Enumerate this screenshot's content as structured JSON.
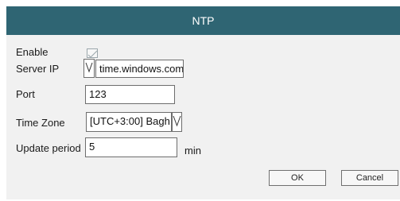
{
  "dialog": {
    "title": "NTP",
    "title_bar_color": "#2f6573"
  },
  "fields": {
    "enable_label": "Enable",
    "enable_checked": true,
    "server_ip_label": "Server IP",
    "server_ip_value": "time.windows.com",
    "port_label": "Port",
    "port_value": "123",
    "time_zone_label": "Time Zone",
    "time_zone_value": "[UTC+3:00] Bagh",
    "update_period_label": "Update period",
    "update_period_value": "5",
    "update_period_unit": "min"
  },
  "buttons": {
    "ok_label": "OK",
    "cancel_label": "Cancel"
  },
  "icons": {
    "dropdown": "triangle-down-icon",
    "checkbox": "checkmark-icon"
  }
}
